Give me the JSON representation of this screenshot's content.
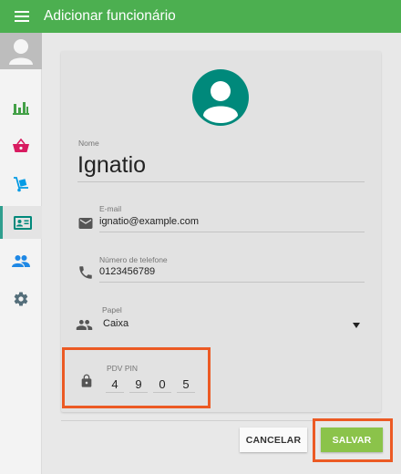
{
  "header": {
    "title": "Adicionar funcionário",
    "color": "#4caf50"
  },
  "sidebar": {
    "items": [
      {
        "icon": "bar-chart-icon",
        "color": "#43a047"
      },
      {
        "icon": "basket-icon",
        "color": "#d81b60"
      },
      {
        "icon": "hand-truck-icon",
        "color": "#039be5"
      },
      {
        "icon": "id-card-icon",
        "color": "#00897b",
        "active": true
      },
      {
        "icon": "people-icon",
        "color": "#1e88e5"
      },
      {
        "icon": "gear-icon",
        "color": "#546e7a"
      }
    ]
  },
  "form": {
    "name_label": "Nome",
    "name_value": "Ignatio",
    "email_label": "E-mail",
    "email_value": "ignatio@example.com",
    "phone_label": "Número de telefone",
    "phone_value": "0123456789",
    "role_label": "Papel",
    "role_value": "Caixa",
    "pin_label": "PDV PIN",
    "pin_digits": [
      "4",
      "9",
      "0",
      "5"
    ]
  },
  "actions": {
    "cancel_label": "CANCELAR",
    "save_label": "SALVAR"
  },
  "colors": {
    "accent": "#4caf50",
    "avatar": "#00897b",
    "highlight": "#ec5a24",
    "save": "#8bc34a"
  }
}
